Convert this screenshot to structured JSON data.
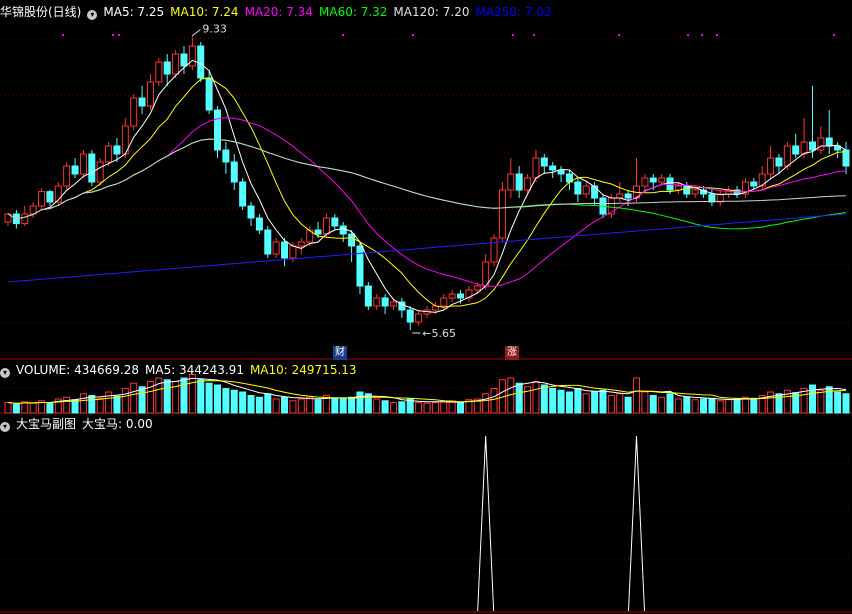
{
  "main_panel": {
    "title": "华锦股份(日线)",
    "ma_labels": [
      {
        "text": "MA5: 7.25",
        "color": "#ffffff"
      },
      {
        "text": "MA10: 7.24",
        "color": "#ffff00"
      },
      {
        "text": "MA20: 7.34",
        "color": "#ff00ff"
      },
      {
        "text": "MA60: 7.32",
        "color": "#00ff00"
      },
      {
        "text": "MA120: 7.20",
        "color": "#e0e0e0"
      },
      {
        "text": "MA250: 7.02",
        "color": "#0000ff"
      }
    ],
    "high_label": "9.33",
    "low_label": "5.65",
    "badge_cai": "财",
    "badge_zhang": "涨"
  },
  "volume_panel": {
    "labels": [
      {
        "text": "VOLUME: 434669.28",
        "color": "#ffffff"
      },
      {
        "text": "MA5: 344243.91",
        "color": "#ffffff"
      },
      {
        "text": "MA10: 249715.13",
        "color": "#ffff00"
      }
    ]
  },
  "indicator_panel": {
    "labels": [
      {
        "text": "大宝马副图",
        "color": "#ffffff"
      },
      {
        "text": "大宝马: 0.00",
        "color": "#ffffff"
      }
    ]
  },
  "colors": {
    "up": "#ff3232",
    "down": "#54ffff",
    "grid": "#800000",
    "separator": "#b00000"
  },
  "chart_data": [
    {
      "type": "candlestick",
      "title": "华锦股份(日线)",
      "price_range": [
        5.4,
        9.5
      ],
      "high": 9.33,
      "low": 5.65,
      "candles": [
        [
          7.0,
          7.1,
          6.95,
          7.12
        ],
        [
          7.1,
          6.98,
          6.92,
          7.15
        ],
        [
          6.98,
          7.1,
          6.95,
          7.2
        ],
        [
          7.1,
          7.2,
          7.05,
          7.25
        ],
        [
          7.2,
          7.38,
          7.15,
          7.42
        ],
        [
          7.38,
          7.25,
          7.2,
          7.4
        ],
        [
          7.25,
          7.45,
          7.2,
          7.5
        ],
        [
          7.45,
          7.7,
          7.4,
          7.75
        ],
        [
          7.7,
          7.6,
          7.55,
          7.8
        ],
        [
          7.6,
          7.85,
          7.55,
          7.9
        ],
        [
          7.85,
          7.5,
          7.45,
          7.9
        ],
        [
          7.5,
          7.75,
          7.45,
          7.8
        ],
        [
          7.75,
          7.95,
          7.7,
          8.0
        ],
        [
          7.95,
          7.85,
          7.75,
          8.05
        ],
        [
          7.85,
          8.2,
          7.8,
          8.3
        ],
        [
          8.2,
          8.55,
          8.15,
          8.6
        ],
        [
          8.55,
          8.45,
          8.35,
          8.7
        ],
        [
          8.45,
          8.75,
          8.4,
          8.85
        ],
        [
          8.75,
          9.0,
          8.7,
          9.05
        ],
        [
          9.0,
          8.85,
          8.7,
          9.1
        ],
        [
          8.85,
          9.1,
          8.8,
          9.15
        ],
        [
          9.1,
          8.95,
          8.85,
          9.2
        ],
        [
          8.95,
          9.2,
          8.9,
          9.33
        ],
        [
          9.2,
          8.8,
          8.75,
          9.25
        ],
        [
          8.8,
          8.4,
          8.35,
          8.9
        ],
        [
          8.4,
          7.9,
          7.8,
          8.45
        ],
        [
          7.9,
          7.75,
          7.6,
          8.0
        ],
        [
          7.75,
          7.5,
          7.4,
          7.85
        ],
        [
          7.5,
          7.2,
          7.15,
          7.55
        ],
        [
          7.2,
          7.05,
          6.95,
          7.25
        ],
        [
          7.05,
          6.9,
          6.85,
          7.1
        ],
        [
          6.9,
          6.6,
          6.55,
          6.95
        ],
        [
          6.6,
          6.75,
          6.55,
          6.8
        ],
        [
          6.75,
          6.55,
          6.45,
          6.8
        ],
        [
          6.55,
          6.7,
          6.5,
          6.75
        ],
        [
          6.7,
          6.75,
          6.6,
          6.8
        ],
        [
          6.75,
          6.9,
          6.7,
          6.95
        ],
        [
          6.9,
          6.85,
          6.8,
          7.0
        ],
        [
          6.85,
          7.05,
          6.8,
          7.1
        ],
        [
          7.05,
          6.95,
          6.9,
          7.1
        ],
        [
          6.95,
          6.85,
          6.75,
          7.0
        ],
        [
          6.85,
          6.7,
          6.5,
          6.9
        ],
        [
          6.7,
          6.2,
          6.1,
          6.75
        ],
        [
          6.2,
          5.95,
          5.9,
          6.25
        ],
        [
          5.95,
          6.05,
          5.9,
          6.1
        ],
        [
          6.05,
          5.95,
          5.85,
          6.1
        ],
        [
          5.95,
          6.0,
          5.9,
          6.05
        ],
        [
          6.0,
          5.9,
          5.8,
          6.05
        ],
        [
          5.9,
          5.75,
          5.65,
          5.95
        ],
        [
          5.75,
          5.85,
          5.7,
          5.9
        ],
        [
          5.85,
          5.9,
          5.8,
          5.95
        ],
        [
          5.9,
          5.95,
          5.85,
          6.0
        ],
        [
          5.95,
          6.05,
          5.9,
          6.1
        ],
        [
          6.05,
          6.1,
          6.0,
          6.15
        ],
        [
          6.1,
          6.05,
          5.98,
          6.15
        ],
        [
          6.05,
          6.15,
          6.0,
          6.2
        ],
        [
          6.15,
          6.2,
          6.1,
          6.25
        ],
        [
          6.2,
          6.5,
          6.15,
          6.6
        ],
        [
          6.5,
          6.8,
          6.45,
          6.85
        ],
        [
          6.8,
          7.4,
          6.75,
          7.5
        ],
        [
          7.4,
          7.6,
          7.3,
          7.8
        ],
        [
          7.6,
          7.4,
          7.3,
          7.7
        ],
        [
          7.4,
          7.55,
          7.35,
          7.6
        ],
        [
          7.55,
          7.8,
          7.5,
          7.9
        ],
        [
          7.8,
          7.7,
          7.6,
          7.85
        ],
        [
          7.7,
          7.65,
          7.55,
          7.75
        ],
        [
          7.65,
          7.6,
          7.5,
          7.7
        ],
        [
          7.6,
          7.5,
          7.4,
          7.65
        ],
        [
          7.5,
          7.35,
          7.25,
          7.55
        ],
        [
          7.35,
          7.45,
          7.3,
          7.5
        ],
        [
          7.45,
          7.3,
          7.2,
          7.5
        ],
        [
          7.3,
          7.1,
          7.05,
          7.35
        ],
        [
          7.1,
          7.3,
          7.05,
          7.35
        ],
        [
          7.3,
          7.35,
          7.25,
          7.5
        ],
        [
          7.35,
          7.3,
          7.2,
          7.4
        ],
        [
          7.3,
          7.45,
          7.25,
          7.8
        ],
        [
          7.45,
          7.55,
          7.4,
          7.6
        ],
        [
          7.55,
          7.5,
          7.4,
          7.6
        ],
        [
          7.5,
          7.55,
          7.45,
          7.6
        ],
        [
          7.55,
          7.4,
          7.35,
          7.6
        ],
        [
          7.4,
          7.45,
          7.35,
          7.5
        ],
        [
          7.45,
          7.35,
          7.3,
          7.5
        ],
        [
          7.35,
          7.4,
          7.3,
          7.45
        ],
        [
          7.4,
          7.35,
          7.3,
          7.45
        ],
        [
          7.35,
          7.25,
          7.2,
          7.4
        ],
        [
          7.25,
          7.35,
          7.2,
          7.4
        ],
        [
          7.35,
          7.4,
          7.3,
          7.45
        ],
        [
          7.4,
          7.35,
          7.3,
          7.45
        ],
        [
          7.35,
          7.5,
          7.3,
          7.55
        ],
        [
          7.5,
          7.45,
          7.4,
          7.55
        ],
        [
          7.45,
          7.6,
          7.4,
          7.7
        ],
        [
          7.6,
          7.8,
          7.55,
          7.95
        ],
        [
          7.8,
          7.7,
          7.6,
          7.85
        ],
        [
          7.7,
          7.95,
          7.65,
          8.0
        ],
        [
          7.95,
          7.85,
          7.8,
          8.1
        ],
        [
          7.85,
          8.0,
          7.8,
          8.3
        ],
        [
          8.0,
          7.9,
          7.8,
          8.7
        ],
        [
          7.9,
          8.05,
          7.85,
          8.2
        ],
        [
          8.05,
          7.95,
          7.85,
          8.4
        ],
        [
          7.95,
          7.9,
          7.8,
          8.0
        ],
        [
          7.9,
          7.7,
          7.6,
          8.0
        ]
      ],
      "ma_series": [
        "MA5",
        "MA10",
        "MA20",
        "MA60",
        "MA120",
        "MA250"
      ]
    },
    {
      "type": "bar",
      "title": "VOLUME",
      "series": [
        {
          "name": "VOLUME"
        },
        {
          "name": "MA5"
        },
        {
          "name": "MA10"
        }
      ],
      "values": [
        0.3,
        0.25,
        0.32,
        0.28,
        0.35,
        0.3,
        0.4,
        0.45,
        0.38,
        0.55,
        0.5,
        0.42,
        0.6,
        0.48,
        0.7,
        0.85,
        0.75,
        0.9,
        1.0,
        0.95,
        0.9,
        1.0,
        1.1,
        0.95,
        0.85,
        0.8,
        0.7,
        0.65,
        0.6,
        0.5,
        0.45,
        0.55,
        0.4,
        0.45,
        0.35,
        0.4,
        0.45,
        0.38,
        0.5,
        0.42,
        0.4,
        0.45,
        0.6,
        0.55,
        0.4,
        0.35,
        0.3,
        0.32,
        0.4,
        0.3,
        0.28,
        0.3,
        0.32,
        0.35,
        0.3,
        0.38,
        0.4,
        0.55,
        0.7,
        0.95,
        1.0,
        0.85,
        0.75,
        0.9,
        0.8,
        0.7,
        0.65,
        0.6,
        0.7,
        0.55,
        0.6,
        0.65,
        0.5,
        0.55,
        0.45,
        1.0,
        0.6,
        0.5,
        0.45,
        0.55,
        0.4,
        0.45,
        0.38,
        0.4,
        0.42,
        0.35,
        0.38,
        0.4,
        0.45,
        0.42,
        0.5,
        0.6,
        0.55,
        0.65,
        0.58,
        0.7,
        0.8,
        0.65,
        0.75,
        0.6,
        0.55
      ],
      "volume_max": 800000
    },
    {
      "type": "line",
      "title": "大宝马副图",
      "series": [
        {
          "name": "大宝马",
          "spikes_at_index": [
            57,
            75
          ],
          "peak": 1,
          "baseline": 0
        }
      ]
    }
  ]
}
